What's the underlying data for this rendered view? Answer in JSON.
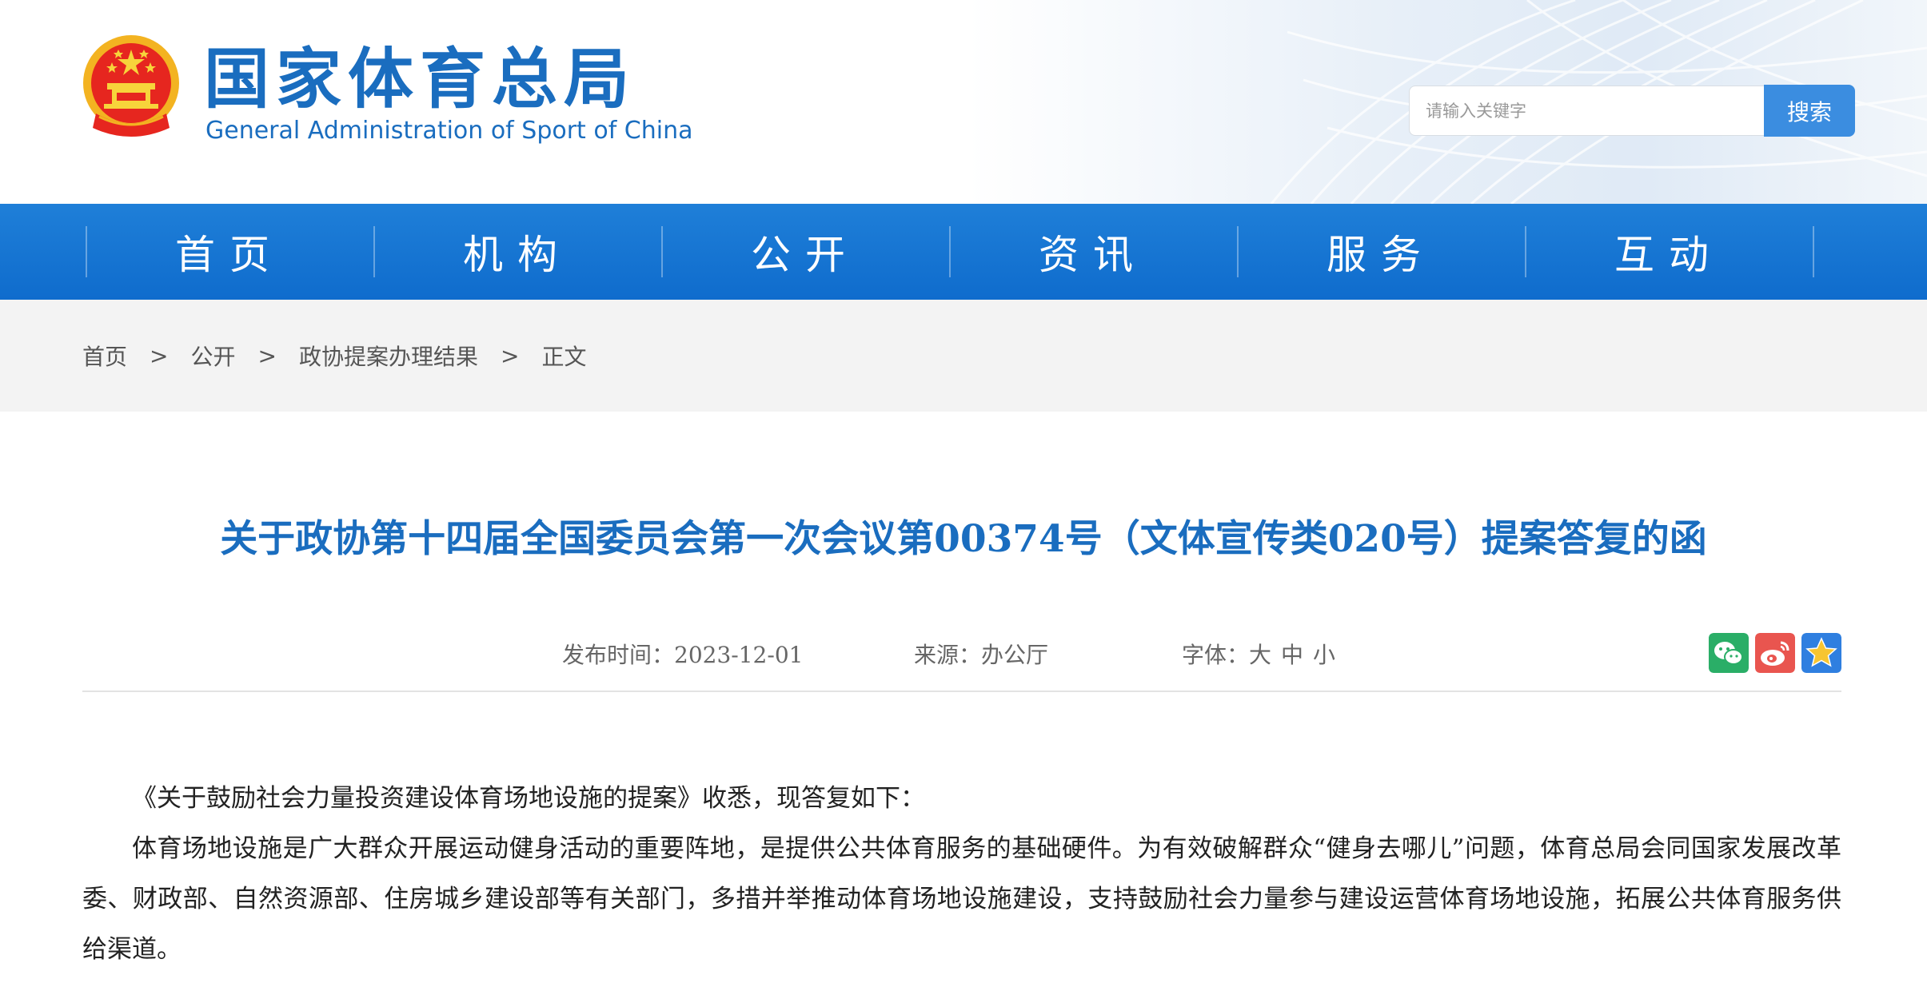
{
  "header": {
    "title_cn": "国家体育总局",
    "title_en": "General Administration of Sport of China",
    "search_placeholder": "请输入关键字",
    "search_button": "搜索"
  },
  "nav": {
    "items": [
      {
        "label": "首页"
      },
      {
        "label": "机构"
      },
      {
        "label": "公开"
      },
      {
        "label": "资讯"
      },
      {
        "label": "服务"
      },
      {
        "label": "互动"
      }
    ]
  },
  "breadcrumb": {
    "items": [
      "首页",
      "公开",
      "政协提案办理结果",
      "正文"
    ],
    "separator": ">"
  },
  "article": {
    "title": "关于政协第十四届全国委员会第一次会议第00374号（文体宣传类020号）提案答复的函",
    "publish_label": "发布时间：",
    "publish_date": "2023-12-01",
    "source_label": "来源：",
    "source": "办公厅",
    "font_label": "字体：",
    "font_sizes": [
      "大",
      "中",
      "小"
    ],
    "paragraphs": [
      "《关于鼓励社会力量投资建设体育场地设施的提案》收悉，现答复如下：",
      "体育场地设施是广大群众开展运动健身活动的重要阵地，是提供公共体育服务的基础硬件。为有效破解群众“健身去哪儿”问题，体育总局会同国家发展改革委、财政部、自然资源部、住房城乡建设部等有关部门，多措并举推动体育场地设施建设，支持鼓励社会力量参与建设运营体育场地设施，拓展公共体育服务供给渠道。"
    ]
  },
  "colors": {
    "brand_blue": "#1a6dbf",
    "nav_blue": "#1478d4",
    "search_button": "#3b8de0",
    "wechat_green": "#2aae67",
    "weibo_red": "#e9554f",
    "favorite_blue": "#2f7fe0"
  },
  "icons": {
    "share_wechat": "wechat-icon",
    "share_weibo": "weibo-icon",
    "share_favorite": "star-icon"
  }
}
